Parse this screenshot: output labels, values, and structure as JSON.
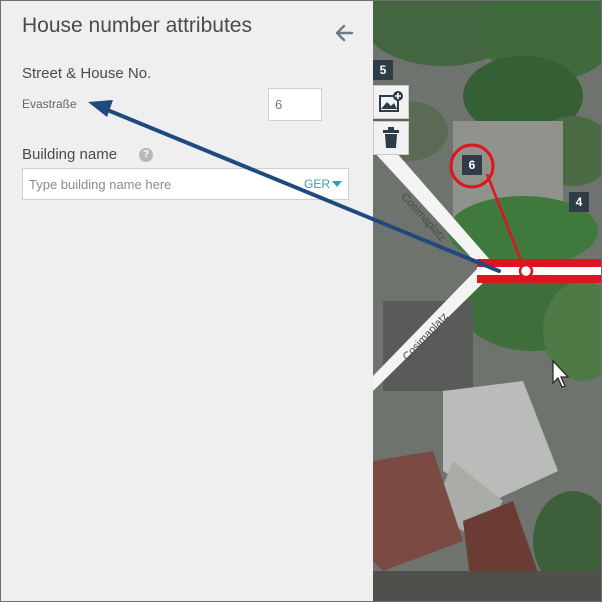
{
  "panel": {
    "title": "House number attributes",
    "street_label": "Street & House No.",
    "street_name": "Evastraße",
    "house_number_value": "6",
    "building_label": "Building name",
    "help_glyph": "?",
    "building_placeholder": "Type building name here",
    "building_value": "",
    "language": "GER"
  },
  "map": {
    "house_numbers": [
      "5",
      "6",
      "4"
    ],
    "street_names": [
      "Cosimaplatz",
      "Cosimaplatz"
    ],
    "tools": [
      {
        "icon": "add-image-icon"
      },
      {
        "icon": "trash-icon"
      }
    ],
    "selection_color": "#e0141e",
    "arrow_color": "#1f4a80"
  }
}
